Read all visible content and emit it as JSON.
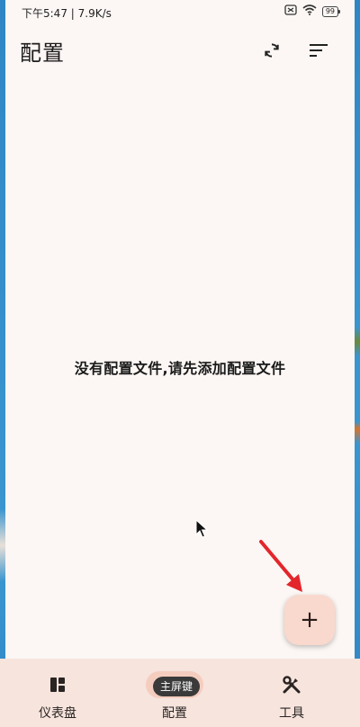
{
  "status_bar": {
    "time_speed": "下午5:47 | 7.9K/s",
    "battery": "99"
  },
  "header": {
    "title": "配置",
    "refresh_icon": "refresh-icon",
    "sort_icon": "sort-icon"
  },
  "main": {
    "empty_message": "没有配置文件,请先添加配置文件"
  },
  "fab": {
    "label": "+"
  },
  "bottom_nav": {
    "items": [
      {
        "label": "仪表盘",
        "icon": "dashboard-icon"
      },
      {
        "label": "配置",
        "icon": "config-icon",
        "selected": true
      },
      {
        "label": "工具",
        "icon": "tools-icon"
      }
    ]
  },
  "tooltip": {
    "text": "主屏键"
  },
  "colors": {
    "background": "#fcf7f4",
    "fab": "#f9d9cd",
    "nav_bar": "#f6e4dd",
    "nav_selected": "#f5cdbf",
    "annotation_arrow": "#e3262c"
  }
}
